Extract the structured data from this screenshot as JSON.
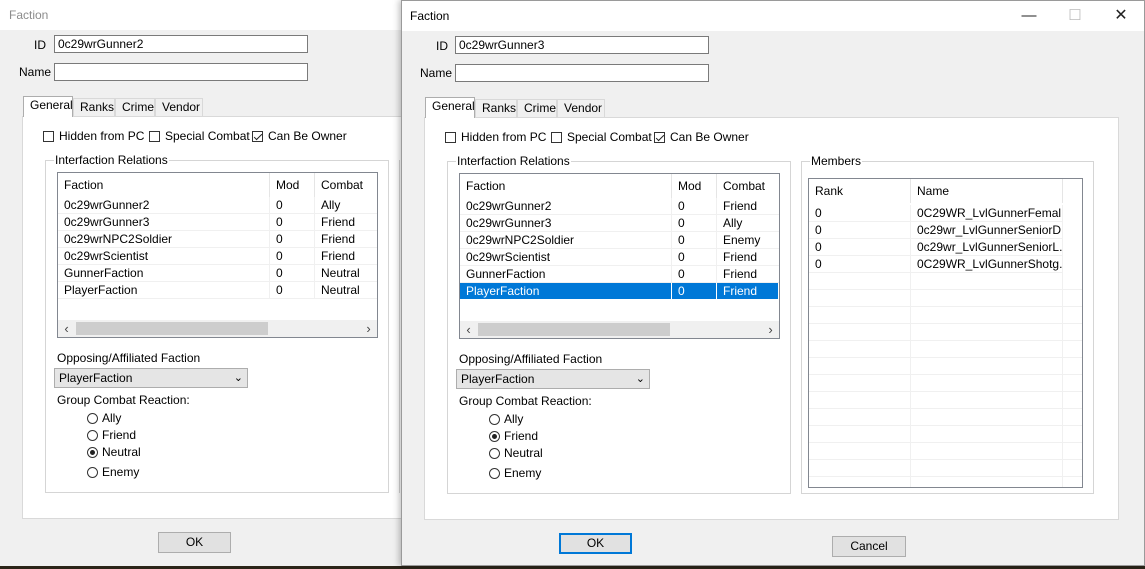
{
  "colors": {
    "selection": "#0078d7",
    "window_bg": "#f0f0f0"
  },
  "win1": {
    "title": "Faction",
    "id_label": "ID",
    "id_value": "0c29wrGunner2",
    "name_label": "Name",
    "name_value": "",
    "tabs": [
      "General",
      "Ranks",
      "Crime",
      "Vendor"
    ],
    "checks": [
      {
        "label": "Hidden from PC",
        "checked": false
      },
      {
        "label": "Special Combat",
        "checked": false
      },
      {
        "label": "Can Be Owner",
        "checked": true
      }
    ],
    "relations_title": "Interfaction Relations",
    "columns": [
      "Faction",
      "Mod",
      "Combat"
    ],
    "rows": [
      {
        "faction": "0c29wrGunner2",
        "mod": "0",
        "combat": "Ally"
      },
      {
        "faction": "0c29wrGunner3",
        "mod": "0",
        "combat": "Friend"
      },
      {
        "faction": "0c29wrNPC2Soldier",
        "mod": "0",
        "combat": "Friend"
      },
      {
        "faction": "0c29wrScientist",
        "mod": "0",
        "combat": "Friend"
      },
      {
        "faction": "GunnerFaction",
        "mod": "0",
        "combat": "Neutral"
      },
      {
        "faction": "PlayerFaction",
        "mod": "0",
        "combat": "Neutral"
      }
    ],
    "opposing_label": "Opposing/Affiliated Faction",
    "opposing_value": "PlayerFaction",
    "reaction_label": "Group Combat Reaction:",
    "reactions": [
      "Ally",
      "Friend",
      "Neutral",
      "Enemy"
    ],
    "reaction_selected": "Neutral",
    "ok_label": "OK"
  },
  "win2": {
    "title": "Faction",
    "minimize_icon": "—",
    "maximize_icon": "☐",
    "close_icon": "✕",
    "id_label": "ID",
    "id_value": "0c29wrGunner3",
    "name_label": "Name",
    "name_value": "",
    "tabs": [
      "General",
      "Ranks",
      "Crime",
      "Vendor"
    ],
    "checks": [
      {
        "label": "Hidden from PC",
        "checked": false
      },
      {
        "label": "Special Combat",
        "checked": false
      },
      {
        "label": "Can Be Owner",
        "checked": true
      }
    ],
    "relations_title": "Interfaction Relations",
    "columns": [
      "Faction",
      "Mod",
      "Combat"
    ],
    "rows": [
      {
        "faction": "0c29wrGunner2",
        "mod": "0",
        "combat": "Friend"
      },
      {
        "faction": "0c29wrGunner3",
        "mod": "0",
        "combat": "Ally"
      },
      {
        "faction": "0c29wrNPC2Soldier",
        "mod": "0",
        "combat": "Enemy"
      },
      {
        "faction": "0c29wrScientist",
        "mod": "0",
        "combat": "Friend"
      },
      {
        "faction": "GunnerFaction",
        "mod": "0",
        "combat": "Friend"
      },
      {
        "faction": "PlayerFaction",
        "mod": "0",
        "combat": "Friend"
      }
    ],
    "selected_row": 5,
    "opposing_label": "Opposing/Affiliated Faction",
    "opposing_value": "PlayerFaction",
    "reaction_label": "Group Combat Reaction:",
    "reactions": [
      "Ally",
      "Friend",
      "Neutral",
      "Enemy"
    ],
    "reaction_selected": "Friend",
    "members_title": "Members",
    "member_columns": [
      "Rank",
      "Name"
    ],
    "members": [
      {
        "rank": "0",
        "name": "0C29WR_LvlGunnerFemal..."
      },
      {
        "rank": "0",
        "name": "0c29wr_LvlGunnerSeniorD..."
      },
      {
        "rank": "0",
        "name": "0c29wr_LvlGunnerSeniorL..."
      },
      {
        "rank": "0",
        "name": "0C29WR_LvlGunnerShotg..."
      }
    ],
    "ok_label": "OK",
    "cancel_label": "Cancel"
  }
}
